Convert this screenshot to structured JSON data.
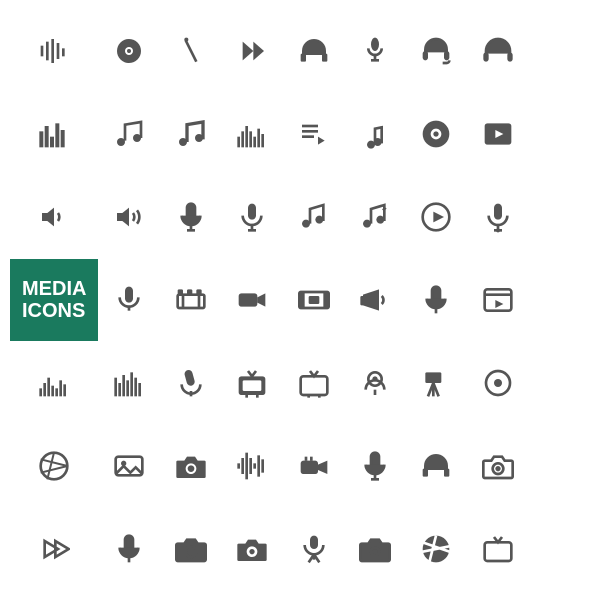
{
  "title": "Media Icons",
  "label": {
    "line1": "MEDIA",
    "line2": "ICONS"
  },
  "color": {
    "icon": "#555555",
    "label_bg": "#1a7a5e",
    "label_text": "#ffffff"
  }
}
